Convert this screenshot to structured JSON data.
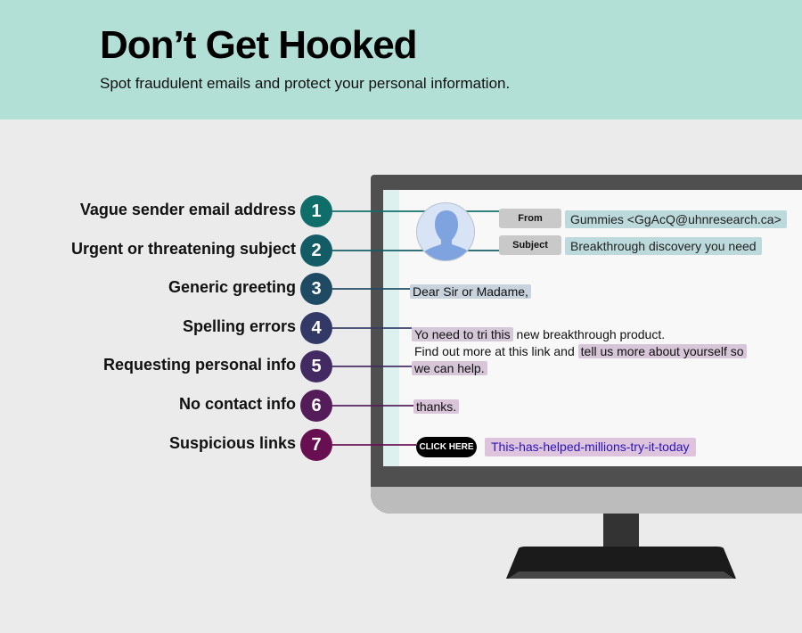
{
  "header": {
    "title": "Don’t Get Hooked",
    "subtitle": "Spot fraudulent emails and protect your personal information."
  },
  "tips": [
    {
      "number": "1",
      "label": "Vague sender email address",
      "color": "#0f6e6a"
    },
    {
      "number": "2",
      "label": "Urgent or threatening subject",
      "color": "#135c66"
    },
    {
      "number": "3",
      "label": "Generic greeting",
      "color": "#1f4a64"
    },
    {
      "number": "4",
      "label": "Spelling errors",
      "color": "#333966"
    },
    {
      "number": "5",
      "label": "Requesting personal info",
      "color": "#432a63"
    },
    {
      "number": "6",
      "label": "No contact info",
      "color": "#541d5a"
    },
    {
      "number": "7",
      "label": "Suspicious links",
      "color": "#680f52"
    }
  ],
  "email": {
    "from_label": "From",
    "from_value": "Gummies <GgAcQ@uhnresearch.ca>",
    "subject_label": "Subject",
    "subject_value": "Breakthrough discovery you need",
    "greeting": "Dear Sir or Madame,",
    "line1_highlight": "Yo need to tri this",
    "line1_rest": " new breakthrough product.",
    "line2_plain": "Find out more at this link and ",
    "line2_highlight": "tell us more about yourself so",
    "line3_highlight": "we can help.",
    "signoff": "thanks.",
    "button_label": "CLICK HERE",
    "link_text": "This-has-helped-millions-try-it-today"
  },
  "icons": {
    "avatar": "user-silhouette-icon"
  }
}
